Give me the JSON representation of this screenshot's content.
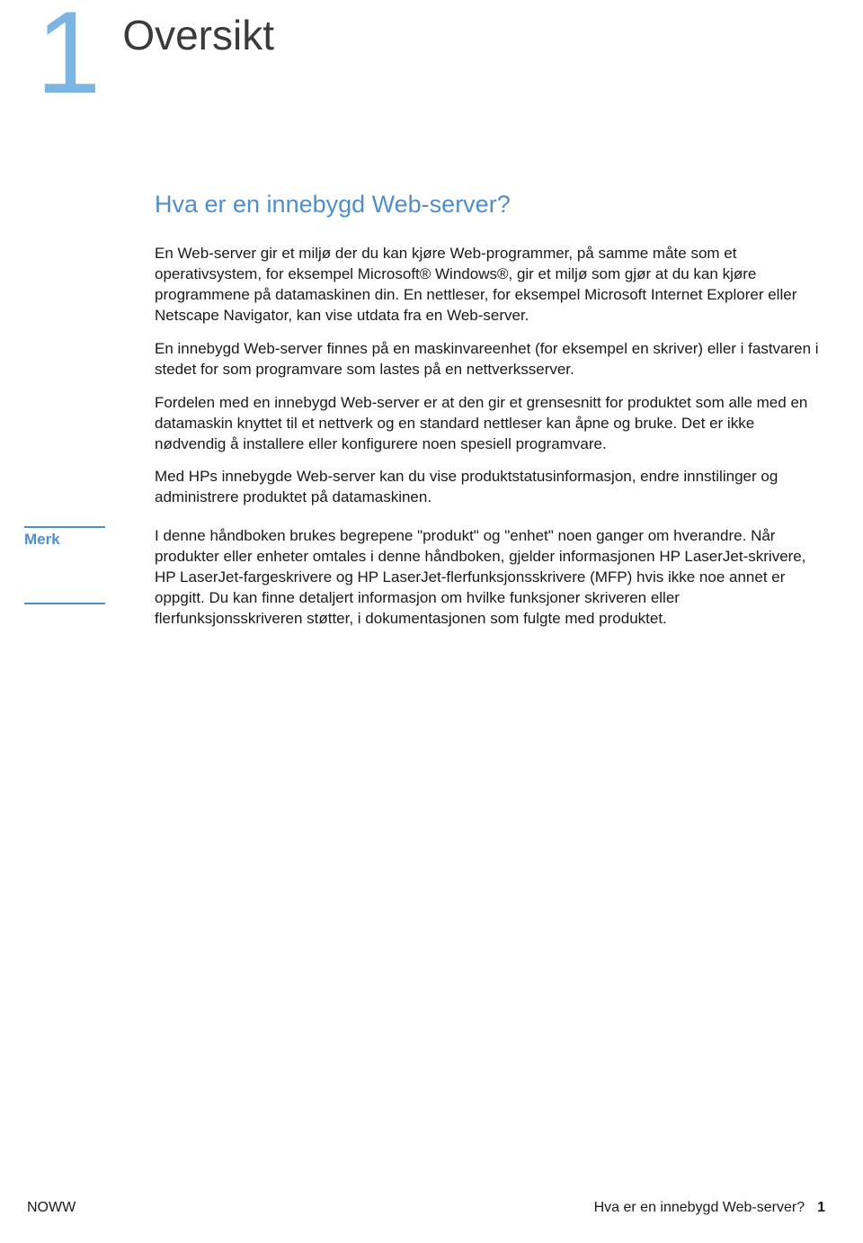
{
  "chapter": {
    "number": "1",
    "title": "Oversikt"
  },
  "section": {
    "heading": "Hva er en innebygd Web-server?",
    "paragraphs": [
      "En Web-server gir et miljø der du kan kjøre Web-programmer, på samme måte som et operativsystem, for eksempel Microsoft® Windows®, gir et miljø som gjør at du kan kjøre programmene på datamaskinen din. En nettleser, for eksempel Microsoft Internet Explorer eller Netscape Navigator, kan vise utdata fra en Web-server.",
      "En innebygd Web-server finnes på en maskinvareenhet (for eksempel en skriver) eller i fastvaren i stedet for som programvare som lastes på en nettverksserver.",
      "Fordelen med en innebygd Web-server er at den gir et grensesnitt for produktet som alle med en datamaskin knyttet til et nettverk og en standard nettleser kan åpne og bruke. Det er ikke nødvendig å installere eller konfigurere noen spesiell programvare.",
      "Med HPs innebygde Web-server kan du vise produktstatusinformasjon, endre innstilinger og administrere produktet på datamaskinen."
    ]
  },
  "note": {
    "label": "Merk",
    "text": "I denne håndboken brukes begrepene \"produkt\" og \"enhet\" noen ganger om hverandre. Når produkter eller enheter omtales i denne håndboken, gjelder informasjonen HP LaserJet-skrivere, HP LaserJet-fargeskrivere og HP LaserJet-flerfunksjonsskrivere (MFP) hvis ikke noe annet er oppgitt. Du kan finne detaljert informasjon om hvilke funksjoner skriveren eller flerfunksjonsskriveren støtter, i dokumentasjonen som fulgte med produktet."
  },
  "footer": {
    "left": "NOWW",
    "right_text": "Hva er en innebygd Web-server?",
    "page_number": "1"
  }
}
